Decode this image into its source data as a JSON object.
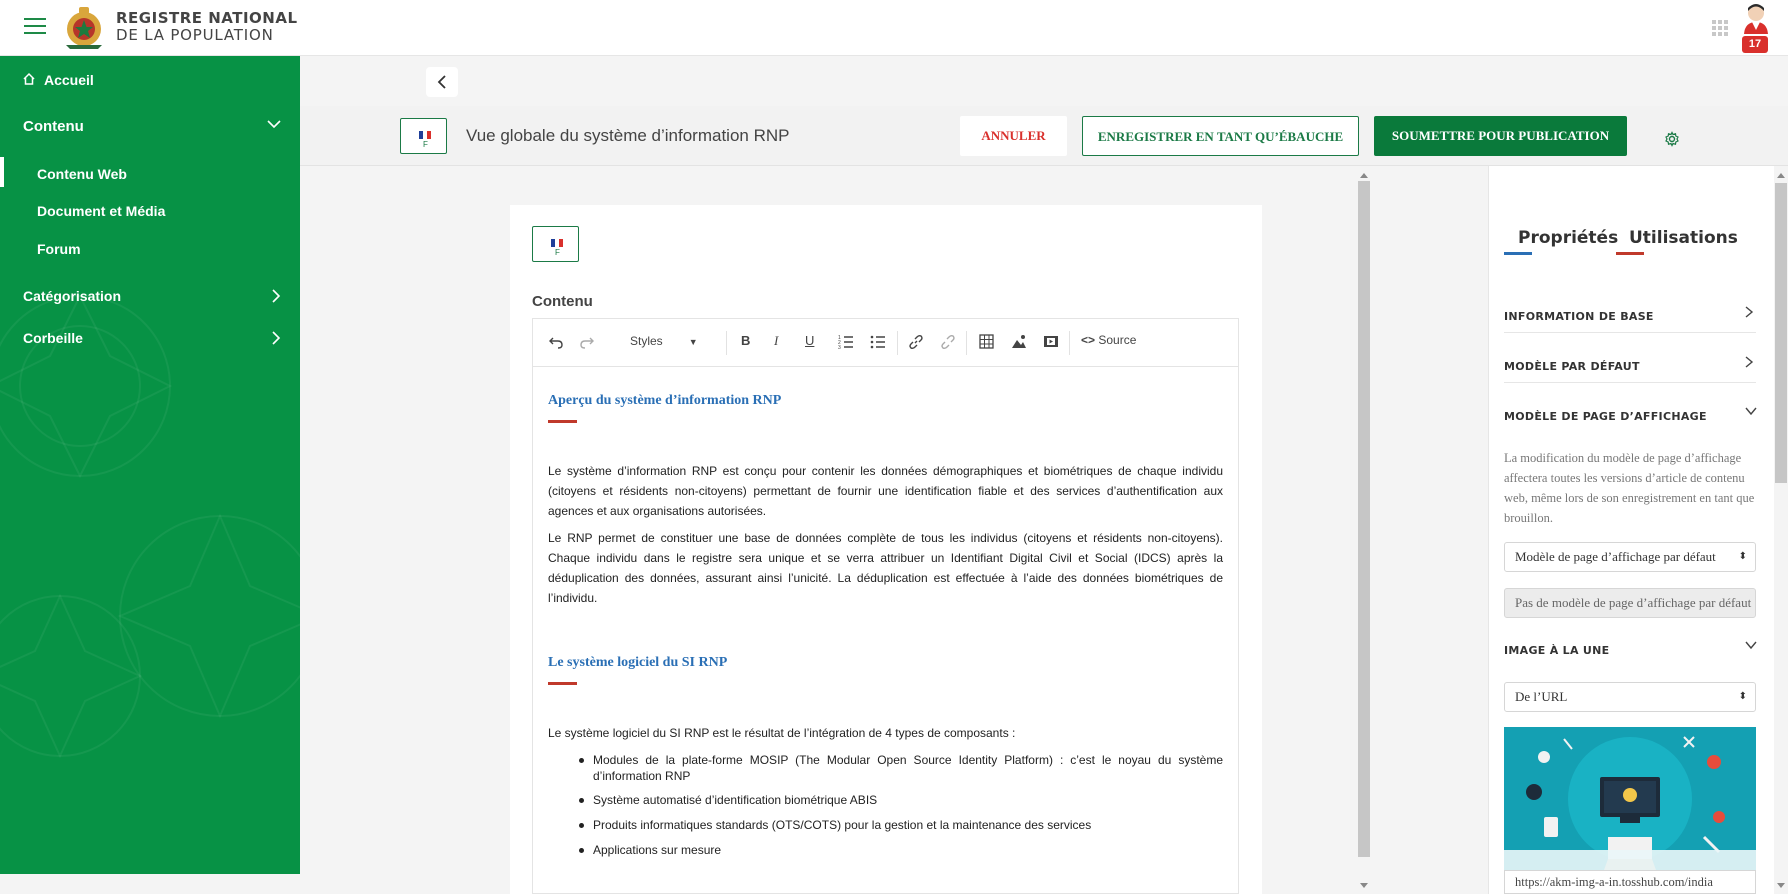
{
  "brand": {
    "line1": "REGISTRE NATIONAL",
    "line2": "DE LA POPULATION"
  },
  "topbar": {
    "notification_count": "17"
  },
  "sidebar": {
    "items": [
      {
        "label": "Accueil",
        "icon": "home-icon"
      },
      {
        "label": "Contenu",
        "icon": "chevron-down-icon"
      },
      {
        "label": "Contenu Web"
      },
      {
        "label": "Document et Média"
      },
      {
        "label": "Forum"
      },
      {
        "label": "Catégorisation",
        "icon": "chevron-right-icon"
      },
      {
        "label": "Corbeille",
        "icon": "chevron-right-icon"
      }
    ]
  },
  "header": {
    "title": "Vue globale du système d’information RNP",
    "cancel": "ANNULER",
    "save_draft": "ENREGISTRER EN TANT QU’ÉBAUCHE",
    "publish": "SOUMETTRE POUR PUBLICATION",
    "language": "F"
  },
  "editor": {
    "language": "F",
    "label": "Contenu",
    "toolbar": {
      "styles": "Styles",
      "source": "Source"
    },
    "heading1": "Aperçu du système d’information RNP",
    "para1": "Le système d’information RNP est conçu pour contenir les données démographiques et biométriques de chaque individu (citoyens et résidents non-citoyens) permettant de fournir une identification fiable et des services d’authentification aux agences et aux organisations autorisées.",
    "para2": "Le RNP permet de constituer une base de données complète de tous les individus (citoyens et résidents non-citoyens). Chaque individu dans le registre sera unique et se verra attribuer un Identifiant Digital Civil et Social (IDCS) après la déduplication des données, assurant ainsi l’unicité. La déduplication est effectuée à l’aide des données biométriques de l’individu.",
    "heading2": "Le système logiciel du SI RNP",
    "para3": "Le système logiciel du SI RNP est le résultat de l’intégration de 4 types de composants :",
    "bullets": [
      "Modules de la plate-forme MOSIP (The Modular Open Source Identity Platform) : c’est le noyau du système d’information RNP",
      "Système automatisé d’identification biométrique ABIS",
      "Produits informatiques standards (OTS/COTS) pour la gestion et la maintenance des services",
      "Applications sur mesure"
    ]
  },
  "panel": {
    "tab_properties": "Propriétés",
    "tab_usages": "Utilisations",
    "sections": {
      "basic_info": "INFORMATION DE BASE",
      "default_template": "MODÈLE PAR DÉFAUT",
      "display_template": "MODÈLE DE PAGE D’AFFICHAGE",
      "featured_image": "IMAGE À LA UNE"
    },
    "display_template_desc": "La modification du modèle de page d’affichage affectera toutes les versions d’article de contenu web, même lors de son enregistrement en tant que brouillon.",
    "display_template_select": "Modèle de page d’affichage par défaut",
    "display_template_none": "Pas de modèle de page d’affichage par défaut",
    "image_source_select": "De l’URL",
    "image_url": "https://akm-img-a-in.tosshub.com/india"
  },
  "colors": {
    "primary_green": "#079245",
    "accent_red": "#d9302c",
    "heading_blue": "#2a6fb5"
  }
}
